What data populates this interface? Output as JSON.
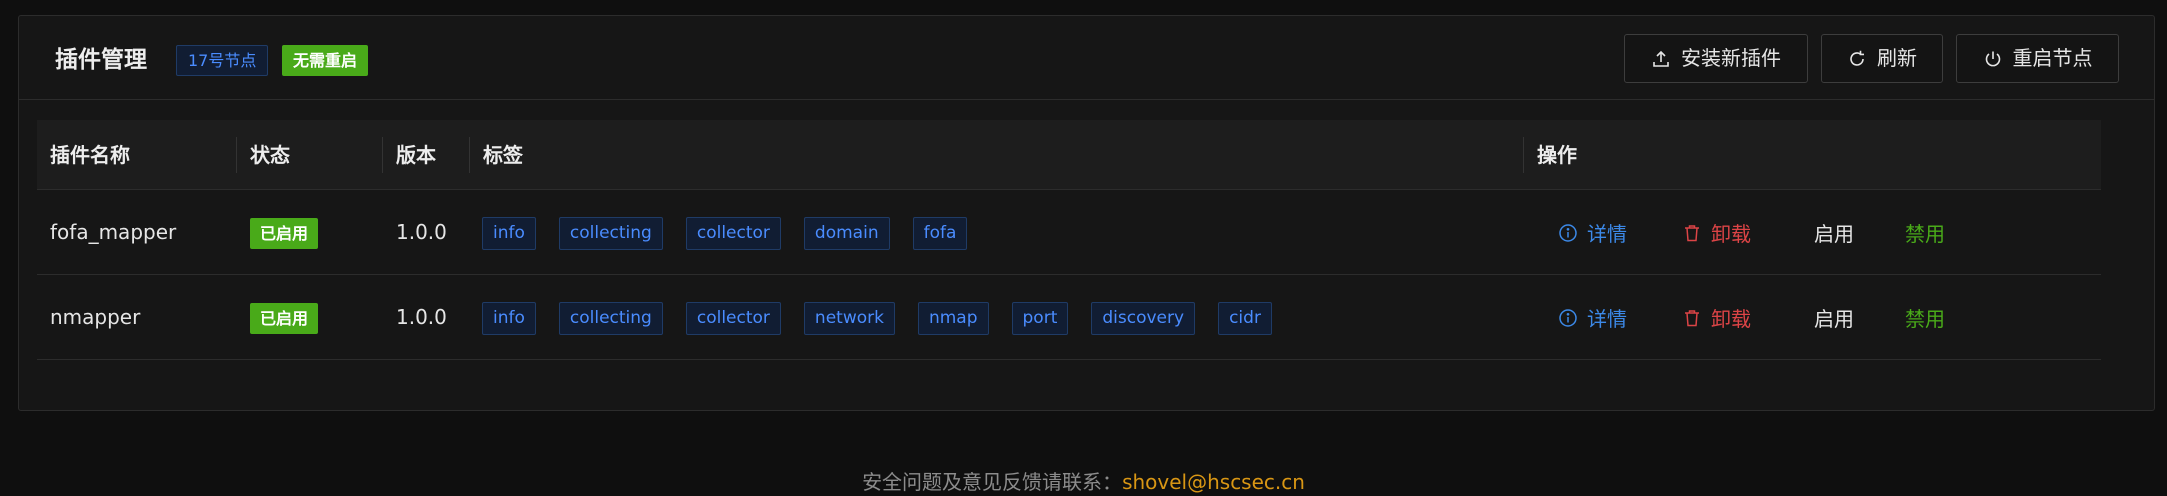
{
  "header": {
    "title": "插件管理",
    "node_tag": "17号节点",
    "restart_tag": "无需重启",
    "buttons": {
      "install": "安装新插件",
      "refresh": "刷新",
      "restart": "重启节点"
    }
  },
  "table": {
    "columns": [
      "插件名称",
      "状态",
      "版本",
      "标签",
      "操作"
    ],
    "rows": [
      {
        "name": "fofa_mapper",
        "status": "已启用",
        "version": "1.0.0",
        "tags": [
          "info",
          "collecting",
          "collector",
          "domain",
          "fofa"
        ]
      },
      {
        "name": "nmapper",
        "status": "已启用",
        "version": "1.0.0",
        "tags": [
          "info",
          "collecting",
          "collector",
          "network",
          "nmap",
          "port",
          "discovery",
          "cidr"
        ]
      }
    ],
    "actions": {
      "detail": "详情",
      "uninstall": "卸载",
      "enable": "启用",
      "disable": "禁用"
    }
  },
  "footer": {
    "text": "安全问题及意见反馈请联系：",
    "email": "shovel@hscsec.cn"
  },
  "colors": {
    "accent_blue": "#3c89e8",
    "success_green": "#49aa19",
    "danger_red": "#dc4446",
    "footer_link": "#d89614"
  },
  "icons": {
    "install": "upload-icon",
    "refresh": "reload-icon",
    "restart": "power-icon",
    "detail": "info-circle-icon",
    "uninstall": "trash-icon"
  }
}
